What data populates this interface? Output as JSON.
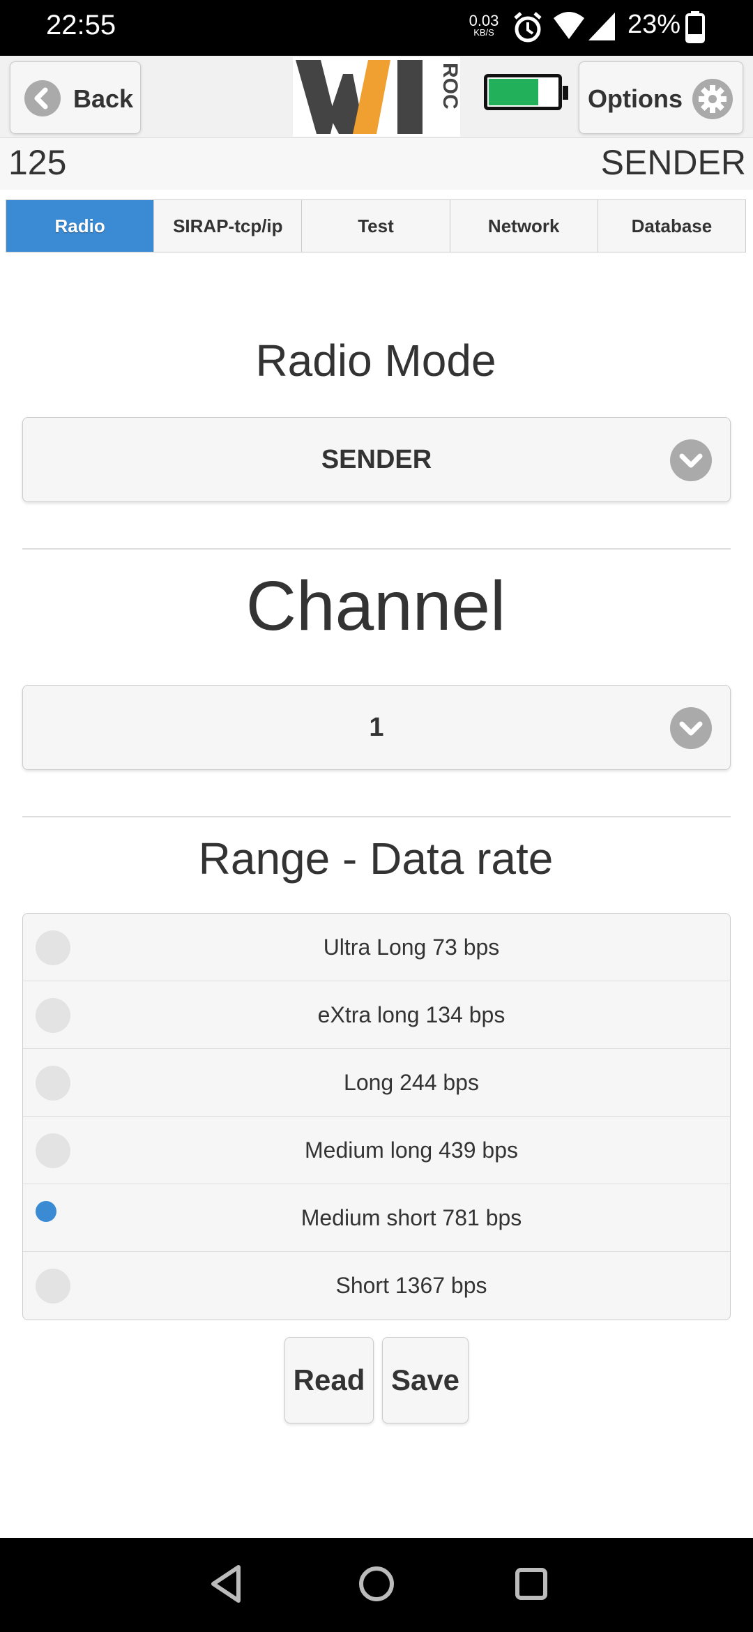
{
  "status_bar": {
    "time": "22:55",
    "net_speed_value": "0.03",
    "net_speed_unit": "KB/S",
    "battery_percent": "23%",
    "icons": [
      "alarm-icon",
      "wifi-icon",
      "signal-icon",
      "battery-icon"
    ]
  },
  "header": {
    "back_label": "Back",
    "options_label": "Options",
    "logo_main": "WI",
    "logo_side": "ROC",
    "device_battery_level": 0.7
  },
  "device": {
    "id": "125",
    "mode": "SENDER"
  },
  "tabs": [
    {
      "label": "Radio",
      "active": true
    },
    {
      "label": "SIRAP-tcp/ip",
      "active": false
    },
    {
      "label": "Test",
      "active": false
    },
    {
      "label": "Network",
      "active": false
    },
    {
      "label": "Database",
      "active": false
    }
  ],
  "radio_mode": {
    "title": "Radio Mode",
    "value": "SENDER"
  },
  "channel": {
    "title": "Channel",
    "value": "1"
  },
  "range": {
    "title": "Range - Data rate",
    "options": [
      {
        "label": "Ultra Long 73 bps",
        "selected": false
      },
      {
        "label": "eXtra long 134 bps",
        "selected": false
      },
      {
        "label": "Long 244 bps",
        "selected": false
      },
      {
        "label": "Medium long 439 bps",
        "selected": false
      },
      {
        "label": "Medium short 781 bps",
        "selected": true
      },
      {
        "label": "Short 1367 bps",
        "selected": false
      }
    ]
  },
  "actions": {
    "read_label": "Read",
    "save_label": "Save"
  },
  "colors": {
    "accent": "#3a8ad4",
    "battery_fill": "#23b05a",
    "logo_orange": "#f0a030",
    "logo_dark": "#444444"
  }
}
